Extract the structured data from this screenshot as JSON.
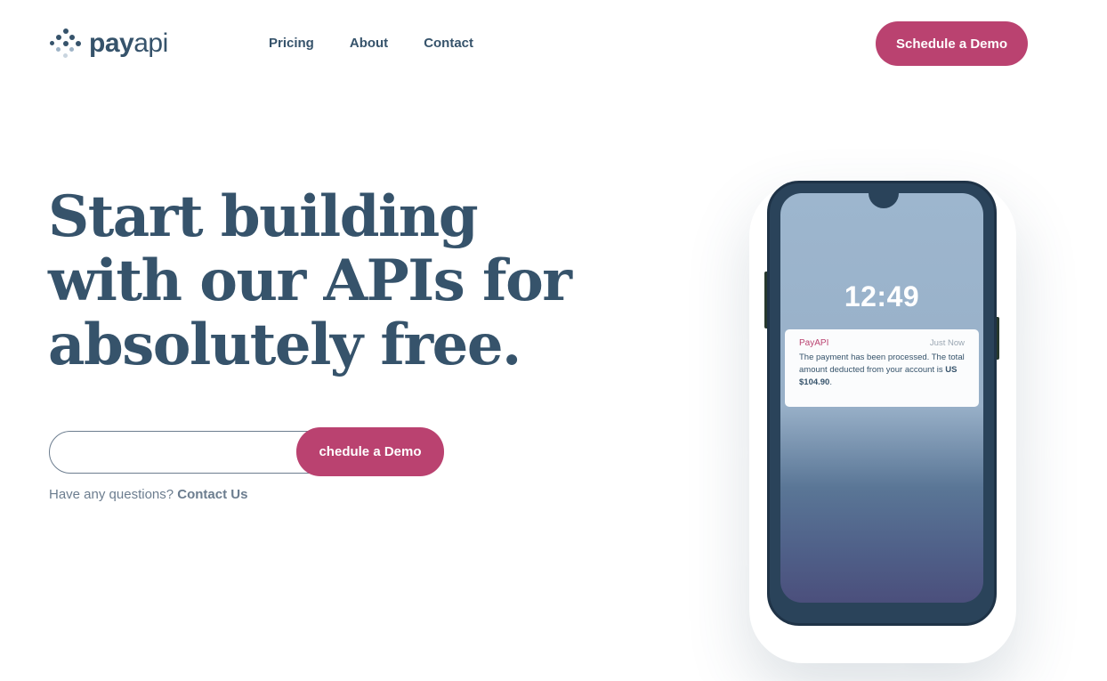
{
  "header": {
    "logo": {
      "pay": "pay",
      "api": "api"
    },
    "nav": [
      {
        "label": "Pricing"
      },
      {
        "label": "About"
      },
      {
        "label": "Contact"
      }
    ],
    "cta_label": "Schedule a Demo"
  },
  "hero": {
    "title_line1": "Start building",
    "title_line2": "with our APIs for",
    "title_line3": "absolutely free.",
    "email": {
      "value": "",
      "placeholder": ""
    },
    "form_cta_label": "chedule a Demo",
    "questions_text": "Have any questions? ",
    "questions_link": "Contact Us"
  },
  "phone": {
    "time": "12:49",
    "notification": {
      "app": "PayAPI",
      "time": "Just Now",
      "body_prefix": "The payment has been processed. The total amount deducted from your account is ",
      "amount": "US $104.90",
      "body_suffix": "."
    }
  },
  "colors": {
    "accent": "#ba4270",
    "text": "#36536b",
    "muted": "#6c7d8f",
    "phone_body": "#2a435a"
  }
}
